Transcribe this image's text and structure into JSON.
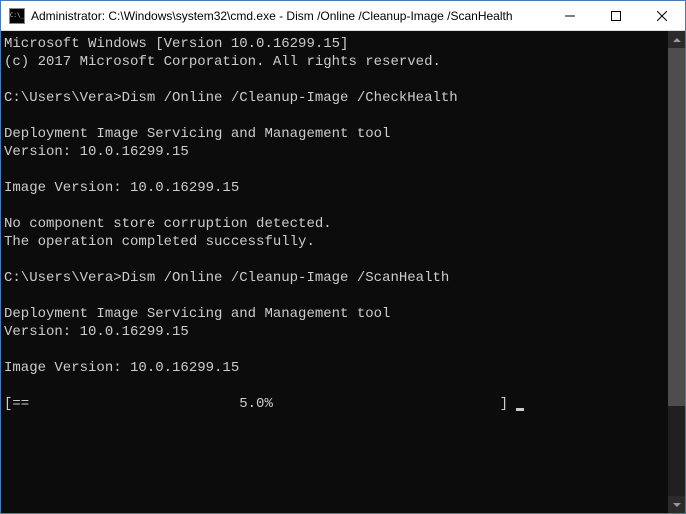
{
  "window": {
    "title": "Administrator: C:\\Windows\\system32\\cmd.exe - Dism  /Online /Cleanup-Image /ScanHealth"
  },
  "terminal": {
    "line1": "Microsoft Windows [Version 10.0.16299.15]",
    "line2": "(c) 2017 Microsoft Corporation. All rights reserved.",
    "blank1": "",
    "prompt1_path": "C:\\Users\\Vera>",
    "prompt1_cmd": "Dism /Online /Cleanup-Image /CheckHealth",
    "blank2": "",
    "tool_name1": "Deployment Image Servicing and Management tool",
    "tool_ver1": "Version: 10.0.16299.15",
    "blank3": "",
    "img_ver1": "Image Version: 10.0.16299.15",
    "blank4": "",
    "result1a": "No component store corruption detected.",
    "result1b": "The operation completed successfully.",
    "blank5": "",
    "prompt2_path": "C:\\Users\\Vera>",
    "prompt2_cmd": "Dism /Online /Cleanup-Image /ScanHealth",
    "blank6": "",
    "tool_name2": "Deployment Image Servicing and Management tool",
    "tool_ver2": "Version: 10.0.16299.15",
    "blank7": "",
    "img_ver2": "Image Version: 10.0.16299.15",
    "blank8": "",
    "progress_line": "[==                         5.0%                           ] "
  },
  "progress": {
    "percent": 5.0
  }
}
